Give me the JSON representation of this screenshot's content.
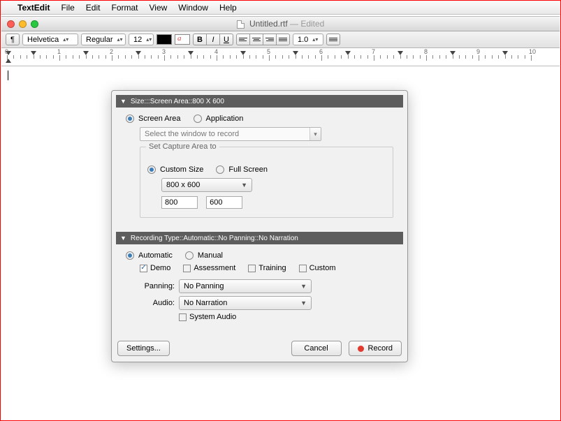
{
  "menubar": {
    "app": "TextEdit",
    "items": [
      "File",
      "Edit",
      "Format",
      "View",
      "Window",
      "Help"
    ]
  },
  "window": {
    "title": "Untitled.rtf",
    "status": " — Edited"
  },
  "toolbar": {
    "styles": "Styles",
    "font": "Helvetica",
    "weight": "Regular",
    "size": "12",
    "bold": "B",
    "italic": "I",
    "underline": "U",
    "spacing": "1.0"
  },
  "ruler": {
    "labels": [
      "0",
      "1",
      "2",
      "3",
      "4",
      "5",
      "6",
      "7",
      "8",
      "9",
      "10"
    ]
  },
  "dialog": {
    "size_header": "Size:::Screen Area::800 X 600",
    "mode_screen": "Screen Area",
    "mode_app": "Application",
    "select_window_placeholder": "Select the window to record",
    "fieldset_legend": "Set Capture Area to",
    "custom_size": "Custom Size",
    "full_screen": "Full Screen",
    "resolution": "800 x 600",
    "width": "800",
    "height": "600",
    "rec_header": "Recording Type::Automatic::No Panning::No Narration",
    "rec_auto": "Automatic",
    "rec_manual": "Manual",
    "chk_demo": "Demo",
    "chk_assessment": "Assessment",
    "chk_training": "Training",
    "chk_custom": "Custom",
    "panning_label": "Panning:",
    "panning_value": "No Panning",
    "audio_label": "Audio:",
    "audio_value": "No Narration",
    "system_audio": "System Audio",
    "settings": "Settings...",
    "cancel": "Cancel",
    "record": "Record"
  }
}
